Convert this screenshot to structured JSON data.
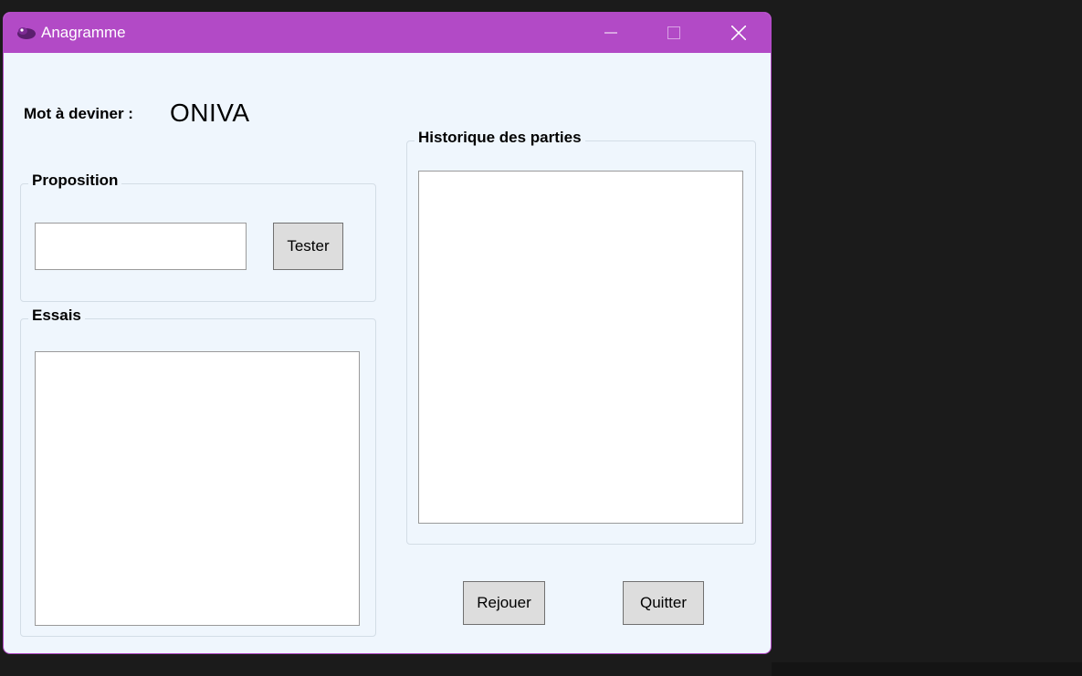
{
  "window": {
    "title": "Anagramme",
    "accent": "#b24ac6",
    "background": "#eff6fd"
  },
  "title_bar_icons": [
    "app-icon",
    "minimize-icon",
    "maximize-icon",
    "close-icon"
  ],
  "word": {
    "label": "Mot à deviner :",
    "value": "ONIVA"
  },
  "proposition": {
    "legend": "Proposition",
    "input_value": "",
    "test_button": "Tester"
  },
  "essais": {
    "legend": "Essais",
    "items": []
  },
  "historique": {
    "legend": "Historique des parties",
    "items": []
  },
  "actions": {
    "replay_button": "Rejouer",
    "quit_button": "Quitter"
  }
}
